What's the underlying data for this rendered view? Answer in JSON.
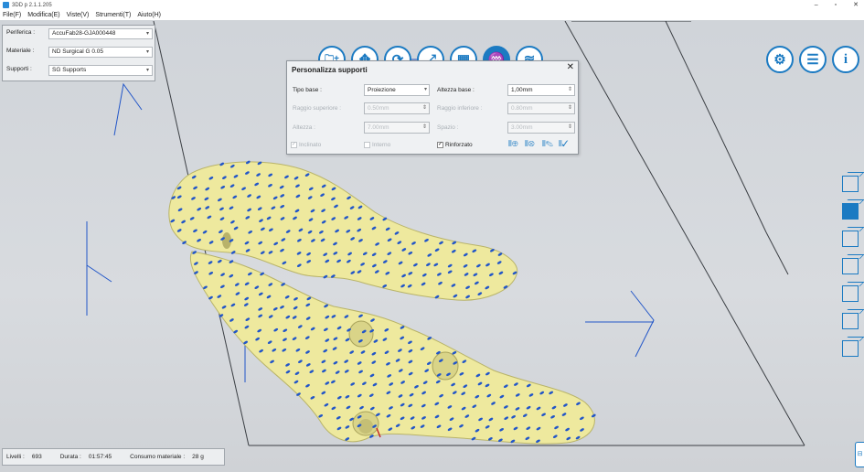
{
  "window": {
    "title": "3DD p 2.1.1.205",
    "minimize": "–",
    "restore": "▫",
    "close": "✕"
  },
  "menu": [
    {
      "label": "File(F)"
    },
    {
      "label": "Modifica(E)"
    },
    {
      "label": "Viste(V)"
    },
    {
      "label": "Strumenti(T)"
    },
    {
      "label": "Aiuto(H)"
    }
  ],
  "properties": {
    "device_label": "Periferica :",
    "device_value": "AccuFab28-GJA000448",
    "material_label": "Materiale :",
    "material_value": "ND Surgical G 0.05",
    "supports_label": "Supporti :",
    "supports_value": "SG Supports"
  },
  "toolbar": {
    "import": "🗀+",
    "move": "✥",
    "rotate": "⟳",
    "scale": "⤢",
    "layout": "▦",
    "supports": "♒",
    "slice": "≋",
    "settings": "⚙",
    "report": "☰",
    "info": "i"
  },
  "dialog": {
    "title": "Personalizza supporti",
    "close": "✕",
    "base_type_label": "Tipo base :",
    "base_type_value": "Proiezione",
    "base_height_label": "Altezza base :",
    "base_height_value": "1,00mm",
    "upper_radius_label": "Raggio superiore :",
    "upper_radius_value": "0.50mm",
    "lower_radius_label": "Raggio inferiore :",
    "lower_radius_value": "0.80mm",
    "height_label": "Altezza :",
    "height_value": "7.00mm",
    "spacing_label": "Spazio :",
    "spacing_value": "3.00mm",
    "check_inclined": "Inclinato",
    "check_internal": "Interno",
    "check_reinforced": "Rinforzato",
    "check_reinforced_mark": "✓",
    "check_inclined_mark": "✓"
  },
  "status": {
    "layers_label": "Livelli :",
    "layers_value": "693",
    "duration_label": "Durata :",
    "duration_value": "01:57:45",
    "material_label": "Consumo materiale :",
    "material_value": "28 g"
  },
  "colors": {
    "accent": "#1b7ac2",
    "model": "#efeb9f",
    "support_dots": "#2256c8"
  }
}
